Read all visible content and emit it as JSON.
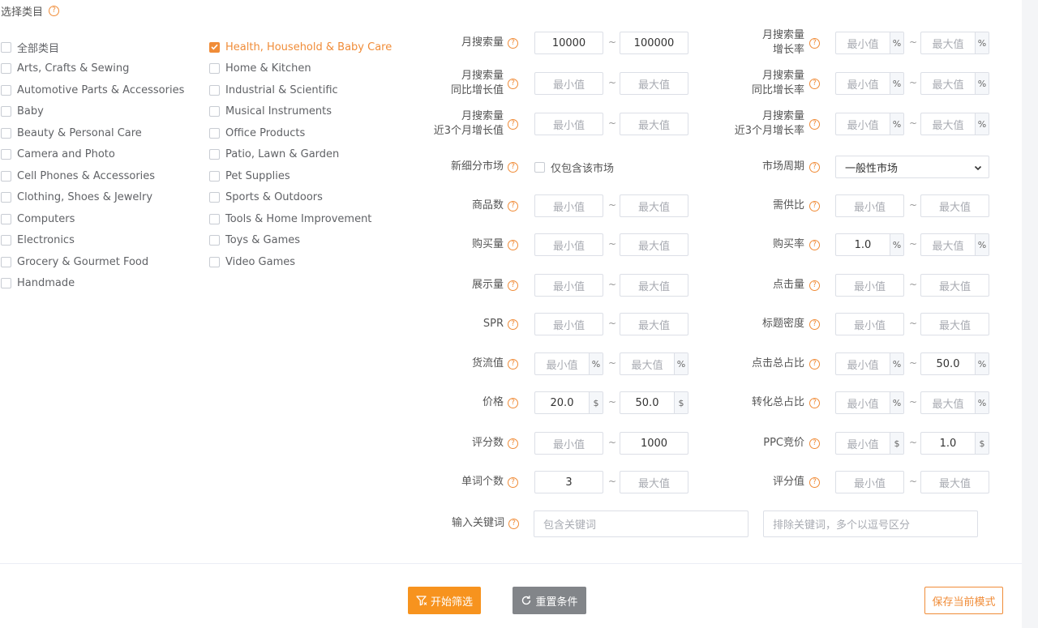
{
  "section_title": "选择类目",
  "categories_left": [
    {
      "label": "全部类目",
      "checked": false
    },
    {
      "label": "Arts, Crafts & Sewing",
      "checked": false
    },
    {
      "label": "Automotive Parts & Accessories",
      "checked": false
    },
    {
      "label": "Baby",
      "checked": false
    },
    {
      "label": "Beauty & Personal Care",
      "checked": false
    },
    {
      "label": "Camera and Photo",
      "checked": false
    },
    {
      "label": "Cell Phones & Accessories",
      "checked": false
    },
    {
      "label": "Clothing, Shoes & Jewelry",
      "checked": false
    },
    {
      "label": "Computers",
      "checked": false
    },
    {
      "label": "Electronics",
      "checked": false
    },
    {
      "label": "Grocery & Gourmet Food",
      "checked": false
    },
    {
      "label": "Handmade",
      "checked": false
    }
  ],
  "categories_right": [
    {
      "label": "Health, Household & Baby Care",
      "checked": true
    },
    {
      "label": "Home & Kitchen",
      "checked": false
    },
    {
      "label": "Industrial & Scientific",
      "checked": false
    },
    {
      "label": "Musical Instruments",
      "checked": false
    },
    {
      "label": "Office Products",
      "checked": false
    },
    {
      "label": "Patio, Lawn & Garden",
      "checked": false
    },
    {
      "label": "Pet Supplies",
      "checked": false
    },
    {
      "label": "Sports & Outdoors",
      "checked": false
    },
    {
      "label": "Tools & Home Improvement",
      "checked": false
    },
    {
      "label": "Toys & Games",
      "checked": false
    },
    {
      "label": "Video Games",
      "checked": false
    }
  ],
  "placeholders": {
    "min": "最小值",
    "max": "最大值"
  },
  "left_filters": [
    {
      "label": [
        "月搜索量"
      ],
      "min": "10000",
      "max": "100000",
      "unit": ""
    },
    {
      "label": [
        "月搜索量",
        "同比增长值"
      ],
      "min": "",
      "max": "",
      "unit": ""
    },
    {
      "label": [
        "月搜索量",
        "近3个月增长值"
      ],
      "min": "",
      "max": "",
      "unit": ""
    },
    {
      "label": [
        "新细分市场"
      ],
      "checkbox": "仅包含该市场"
    },
    {
      "label": [
        "商品数"
      ],
      "min": "",
      "max": "",
      "unit": ""
    },
    {
      "label": [
        "购买量"
      ],
      "min": "",
      "max": "",
      "unit": ""
    },
    {
      "label": [
        "展示量"
      ],
      "min": "",
      "max": "",
      "unit": ""
    },
    {
      "label": [
        "SPR"
      ],
      "min": "",
      "max": "",
      "unit": ""
    },
    {
      "label": [
        "货流值"
      ],
      "min": "",
      "max": "",
      "unit": "%"
    },
    {
      "label": [
        "价格"
      ],
      "min": "20.0",
      "max": "50.0",
      "unit": "$"
    },
    {
      "label": [
        "评分数"
      ],
      "min": "",
      "max": "1000",
      "unit": ""
    },
    {
      "label": [
        "单词个数"
      ],
      "min": "3",
      "max": "",
      "unit": ""
    }
  ],
  "right_filters": [
    {
      "label": [
        "月搜索量",
        "增长率"
      ],
      "min": "",
      "max": "",
      "unit": "%"
    },
    {
      "label": [
        "月搜索量",
        "同比增长率"
      ],
      "min": "",
      "max": "",
      "unit": "%"
    },
    {
      "label": [
        "月搜索量",
        "近3个月增长率"
      ],
      "min": "",
      "max": "",
      "unit": "%"
    },
    {
      "label": [
        "市场周期"
      ],
      "select": "一般性市场"
    },
    {
      "label": [
        "需供比"
      ],
      "min": "",
      "max": "",
      "unit": ""
    },
    {
      "label": [
        "购买率"
      ],
      "min": "1.0",
      "max": "",
      "unit": "%"
    },
    {
      "label": [
        "点击量"
      ],
      "min": "",
      "max": "",
      "unit": ""
    },
    {
      "label": [
        "标题密度"
      ],
      "min": "",
      "max": "",
      "unit": ""
    },
    {
      "label": [
        "点击总占比"
      ],
      "min": "",
      "max": "50.0",
      "unit": "%"
    },
    {
      "label": [
        "转化总占比"
      ],
      "min": "",
      "max": "",
      "unit": "%"
    },
    {
      "label": [
        "PPC竞价"
      ],
      "min": "",
      "max": "1.0",
      "unit": "$"
    },
    {
      "label": [
        "评分值"
      ],
      "min": "",
      "max": "",
      "unit": ""
    }
  ],
  "keyword": {
    "label": "输入关键词",
    "include_placeholder": "包含关键词",
    "exclude_placeholder": "排除关键词，多个以逗号区分"
  },
  "buttons": {
    "start": "开始筛选",
    "reset": "重置条件",
    "save": "保存当前模式"
  },
  "colors": {
    "accent": "#f08c38",
    "primary_button": "#f7931e",
    "reset_button": "#828589"
  }
}
